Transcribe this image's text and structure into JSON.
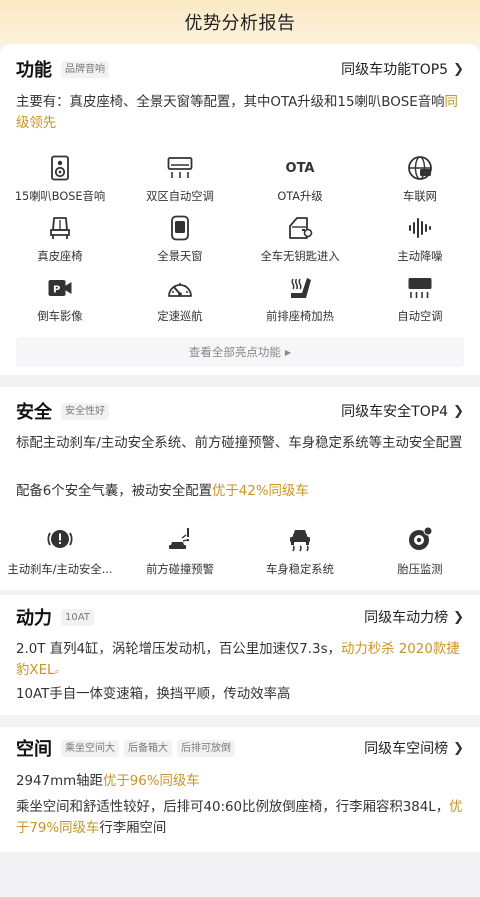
{
  "page_title": "优势分析报告",
  "features": {
    "title": "功能",
    "tag": "品牌音响",
    "more": "同级车功能TOP5",
    "desc_main": "主要有：真皮座椅、全景天窗等配置，其中OTA升级和15喇叭BOSE音响",
    "desc_hl": "同级领先",
    "items": [
      {
        "label": "15喇叭BOSE音响",
        "icon": "speaker-icon"
      },
      {
        "label": "双区自动空调",
        "icon": "dual-ac-icon"
      },
      {
        "label": "OTA升级",
        "icon": "ota-icon"
      },
      {
        "label": "车联网",
        "icon": "connected-car-icon"
      },
      {
        "label": "真皮座椅",
        "icon": "leather-seat-icon"
      },
      {
        "label": "全景天窗",
        "icon": "sunroof-icon"
      },
      {
        "label": "全车无钥匙进入",
        "icon": "keyless-entry-icon"
      },
      {
        "label": "主动降噪",
        "icon": "noise-cancel-icon"
      },
      {
        "label": "倒车影像",
        "icon": "reverse-camera-icon"
      },
      {
        "label": "定速巡航",
        "icon": "cruise-control-icon"
      },
      {
        "label": "前排座椅加热",
        "icon": "seat-heating-icon"
      },
      {
        "label": "自动空调",
        "icon": "auto-ac-icon"
      }
    ],
    "ota_text": "OTA",
    "view_all": "查看全部亮点功能"
  },
  "safety": {
    "title": "安全",
    "tag": "安全性好",
    "more": "同级车安全TOP4",
    "desc1": "标配主动刹车/主动安全系统、前方碰撞预警、车身稳定系统等主动安全配置",
    "desc2_main": "配备6个安全气囊，被动安全配置",
    "desc2_hl": "优于42%同级车",
    "items": [
      {
        "label": "主动刹车/主动安全...",
        "icon": "active-brake-icon"
      },
      {
        "label": "前方碰撞预警",
        "icon": "collision-warning-icon"
      },
      {
        "label": "车身稳定系统",
        "icon": "stability-control-icon"
      },
      {
        "label": "胎压监测",
        "icon": "tire-pressure-icon"
      }
    ]
  },
  "power": {
    "title": "动力",
    "tag": "10AT",
    "more": "同级车动力榜",
    "desc1_main": "2.0T 直列4缸，涡轮增压发动机，百公里加速仅7.3s，",
    "desc1_hl": "动力秒杀 2020款捷豹XEL",
    "desc2": "10AT手自一体变速箱，换挡平顺，传动效率高"
  },
  "space": {
    "title": "空间",
    "tags": [
      "乘坐空间大",
      "后备箱大",
      "后排可放倒"
    ],
    "more": "同级车空间榜",
    "desc1_main": "2947mm轴距",
    "desc1_hl": "优于96%同级车",
    "desc2_main": "乘坐空间和舒适性较好，后排可40:60比例放倒座椅，行李厢容积384L，",
    "desc2_hl": "优于79%同级车",
    "desc2_tail": "行李厢空间"
  },
  "colors": {
    "accent": "#c99424",
    "text": "#222222",
    "tag_bg": "#f2f2f4"
  }
}
